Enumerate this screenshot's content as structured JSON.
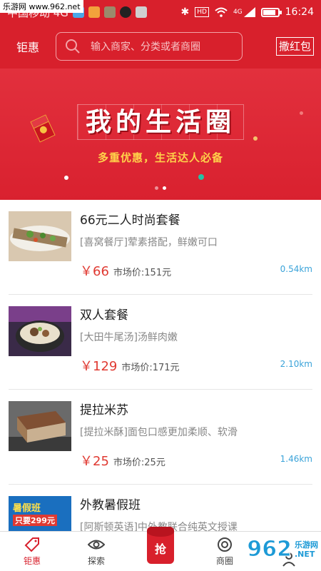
{
  "watermark": {
    "top_text": "乐游网 www.962.net",
    "logo": "962",
    "cn": "乐游网",
    "en": ".NET"
  },
  "status_bar": {
    "carrier": "中国移动 4G",
    "bluetooth": "✱",
    "hd": "HD",
    "network": "4G",
    "battery_level": 0.85,
    "time": "16:24"
  },
  "header": {
    "city": "钜惠",
    "search_placeholder": "输入商家、分类或者商圈",
    "red_packet_button": "撒红包"
  },
  "banner": {
    "title": "我的生活圈",
    "subtitle": "多重优惠，生活达人必备",
    "envelope_symbol": "¥",
    "active_slide": 1,
    "slides": 2
  },
  "deals": [
    {
      "title": "66元二人时尚套餐",
      "desc": "[喜窝餐厅]荤素搭配，鲜嫩可口",
      "price": "￥66",
      "market": "市场价:151元",
      "distance": "0.54km"
    },
    {
      "title": "双人套餐",
      "desc": "[大田牛尾汤]汤鲜肉嫩",
      "price": "￥129",
      "market": "市场价:171元",
      "distance": "2.10km"
    },
    {
      "title": "提拉米苏",
      "desc": "[提拉米酥]面包口感更加柔顺、软滑",
      "price": "￥25",
      "market": "市场价:25元",
      "distance": "1.46km"
    },
    {
      "title": "外教暑假班",
      "desc": "[阿斯顿英语]中外教联合纯英文授课",
      "thumb_text": "暑假班",
      "thumb_price": "只要299元"
    }
  ],
  "bottom_nav": {
    "items": [
      "钜惠",
      "探索",
      "抢",
      "商圈"
    ],
    "active": "钜惠"
  },
  "colors": {
    "brand_red": "#d8202c",
    "price_red": "#e03a32",
    "distance_blue": "#3aa3d9"
  }
}
